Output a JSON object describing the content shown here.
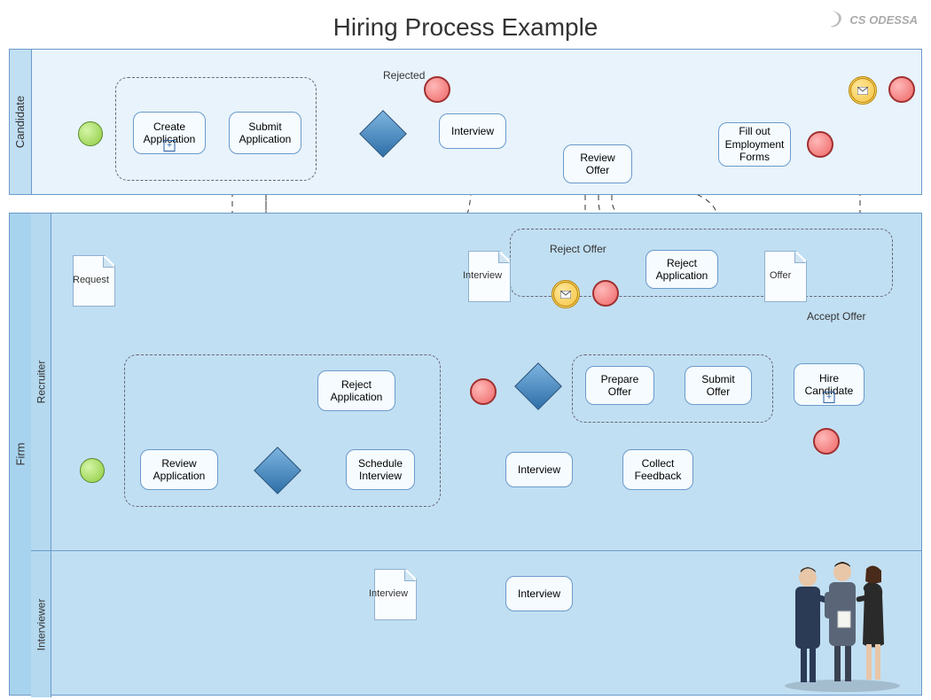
{
  "title": "Hiring Process Example",
  "logo": "CS ODESSA",
  "pools": {
    "candidate": {
      "label": "Candidate"
    },
    "firm": {
      "label": "Firm",
      "lanes": {
        "recruiter": {
          "label": "Recruiter"
        },
        "interviewer": {
          "label": "Interviewer"
        }
      }
    }
  },
  "tasks": {
    "create_app": "Create Application",
    "submit_app": "Submit Application",
    "interview_cand": "Interview",
    "review_offer": "Review Offer",
    "fill_forms": "Fill out Employment Forms",
    "reject_app_top": "Reject Application",
    "reject_app_mid": "Reject Application",
    "review_app": "Review Application",
    "schedule_int": "Schedule Interview",
    "interview_rec": "Interview",
    "collect_feedback": "Collect Feedback",
    "prepare_offer": "Prepare Offer",
    "submit_offer": "Submit Offer",
    "hire_cand": "Hire Candidate",
    "interview_int": "Interview"
  },
  "labels": {
    "rejected": "Rejected",
    "reject_offer": "Reject Offer",
    "accept_offer": "Accept Offer"
  },
  "docs": {
    "request": "Request",
    "interview1": "Interview",
    "interview2": "Interview",
    "offer": "Offer"
  },
  "elements": {
    "start_events": [
      "candidate-start",
      "recruiter-start"
    ],
    "end_events": [
      "candidate-rejected-end",
      "candidate-forms-end",
      "candidate-top-end",
      "recruiter-reject-end",
      "recruiter-reject-offer-end",
      "recruiter-hire-end"
    ],
    "message_events": [
      "candidate-msg-event",
      "recruiter-msg-event"
    ],
    "gateways": [
      "candidate-gateway",
      "recruiter-gateway-1",
      "recruiter-gateway-2"
    ]
  },
  "bpmn_type": "Business Process Diagram (BPMN)",
  "flow_description": "Swimlane diagram with two pools: Candidate and Firm. Firm pool is divided into Recruiter and Interviewer lanes. Solid arrows are sequence flows, dashed arrows are message flows between pools, and dash-dot rectangles are group artifacts."
}
